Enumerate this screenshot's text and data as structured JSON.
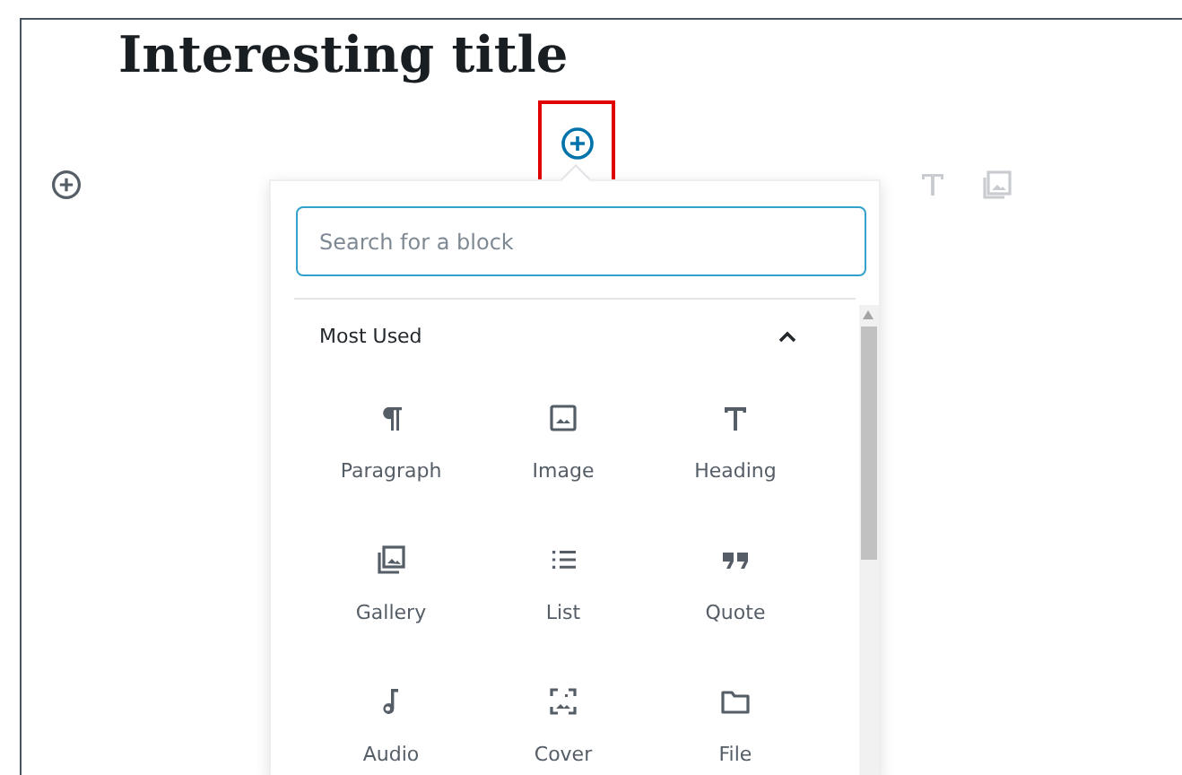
{
  "post_title": "Interesting title",
  "inserter": {
    "highlighted": true
  },
  "popover": {
    "search": {
      "placeholder": "Search for a block"
    },
    "section": {
      "label": "Most Used",
      "expanded": true
    },
    "blocks": [
      {
        "label": "Paragraph"
      },
      {
        "label": "Image"
      },
      {
        "label": "Heading"
      },
      {
        "label": "Gallery"
      },
      {
        "label": "List"
      },
      {
        "label": "Quote"
      },
      {
        "label": "Audio"
      },
      {
        "label": "Cover"
      },
      {
        "label": "File"
      }
    ]
  }
}
